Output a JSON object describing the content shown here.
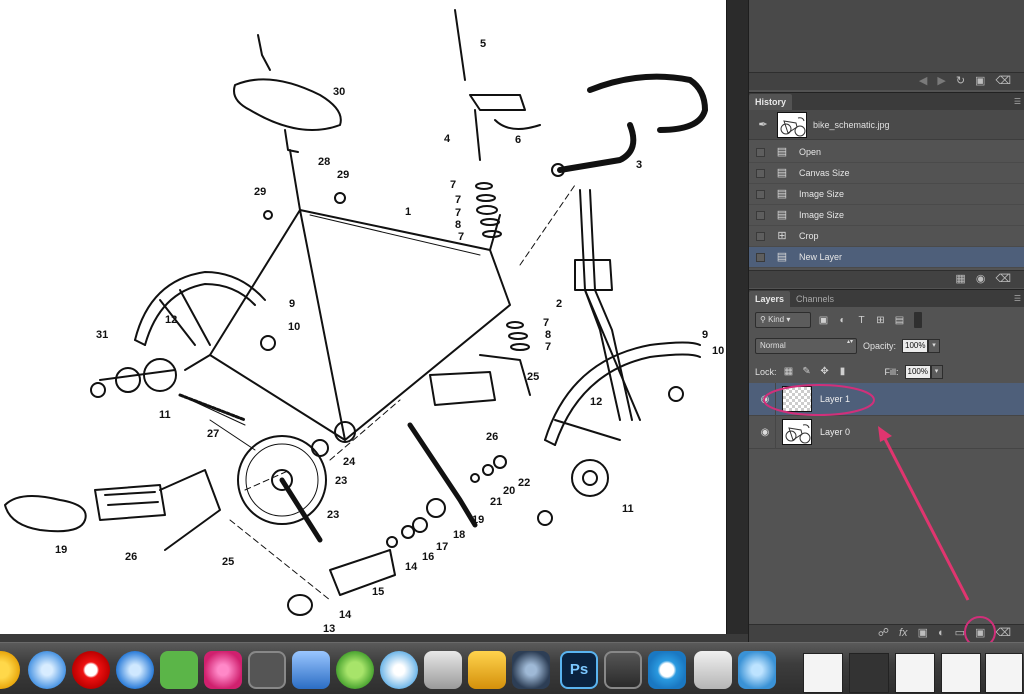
{
  "history": {
    "tab": "History",
    "snapshot_label": "bike_schematic.jpg",
    "items": [
      {
        "label": "Open",
        "icon": "document-icon"
      },
      {
        "label": "Canvas Size",
        "icon": "document-icon"
      },
      {
        "label": "Image Size",
        "icon": "document-icon"
      },
      {
        "label": "Image Size",
        "icon": "document-icon"
      },
      {
        "label": "Crop",
        "icon": "crop-icon"
      },
      {
        "label": "New Layer",
        "icon": "document-icon",
        "selected": true
      }
    ]
  },
  "layers": {
    "tab_layers": "Layers",
    "tab_channels": "Channels",
    "kind_label": "Kind",
    "blend_mode": "Normal",
    "opacity_label": "Opacity:",
    "opacity_value": "100%",
    "lock_label": "Lock:",
    "fill_label": "Fill:",
    "fill_value": "100%",
    "items": [
      {
        "name": "Layer 1",
        "selected": true,
        "visible": true
      },
      {
        "name": "Layer 0",
        "selected": false,
        "visible": true
      }
    ]
  },
  "colors": {
    "highlight_circle": "#d0307a",
    "arrow": "#e0356f",
    "selection": "#4e5f7a"
  },
  "schematic_labels": [
    "1",
    "2",
    "3",
    "4",
    "5",
    "6",
    "7",
    "7",
    "7",
    "7",
    "7",
    "7",
    "8",
    "8",
    "9",
    "9",
    "10",
    "10",
    "11",
    "11",
    "12",
    "12",
    "13",
    "14",
    "14",
    "15",
    "16",
    "17",
    "18",
    "19",
    "19",
    "20",
    "21",
    "22",
    "23",
    "23",
    "24",
    "25",
    "25",
    "26",
    "26",
    "27",
    "28",
    "29",
    "29",
    "30",
    "31"
  ],
  "dock": {
    "apps": [
      "chrome-icon",
      "safari-icon",
      "opera-icon",
      "itunes-icon",
      "evernote-icon",
      "heart-app-icon",
      "steam-icon",
      "screen-sharing-icon",
      "leaf-app-icon",
      "dropzone-icon",
      "utilities-icon",
      "transmit-icon",
      "gear-app-icon",
      "photoshop-icon",
      "sublime-icon",
      "update-icon",
      "calculator-icon",
      "twitter-icon"
    ]
  }
}
